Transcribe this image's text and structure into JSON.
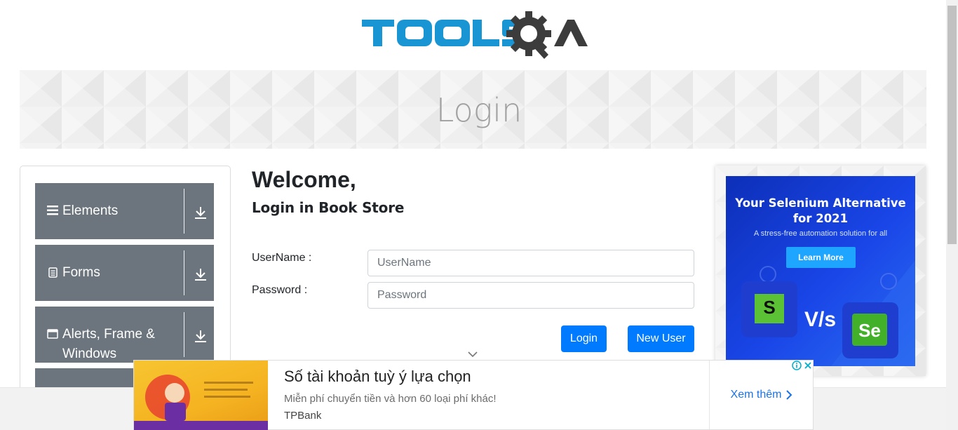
{
  "header": {
    "logo_text": "TOOLSQA"
  },
  "banner": {
    "title": "Login"
  },
  "sidebar": {
    "groups": [
      {
        "label": "Elements",
        "icon": "hamburger-icon"
      },
      {
        "label": "Forms",
        "icon": "document-icon"
      },
      {
        "label": "Alerts, Frame & Windows",
        "label_line1": "Alerts, Frame &",
        "label_line2": "Windows",
        "icon": "window-icon"
      }
    ]
  },
  "main": {
    "welcome": "Welcome,",
    "subtitle": "Login in Book Store",
    "username_label": "UserName :",
    "username_placeholder": "UserName",
    "password_label": "Password :",
    "password_placeholder": "Password",
    "login_button": "Login",
    "new_user_button": "New User"
  },
  "right_ad": {
    "headline": "Your Selenium Alternative for 2021",
    "headline_line1": "Your Selenium Alternative",
    "headline_line2": "for 2021",
    "subtext": "A stress-free automation solution for all",
    "cta": "Learn More",
    "vs_text": "V/s",
    "logo_left": "S",
    "logo_right": "Se"
  },
  "bottom_ad": {
    "headline": "Số tài khoản tuỳ ý lựa chọn",
    "description": "Miễn phí chuyển tiền và hơn 60 loại phí khác!",
    "advertiser": "TPBank",
    "cta": "Xem thêm"
  },
  "colors": {
    "brand_blue": "#1a95d3",
    "logo_gray": "#3c3c3c",
    "sidebar_gray": "#6c757d",
    "button_blue": "#007bff",
    "ad_blue": "#1a46e8"
  }
}
